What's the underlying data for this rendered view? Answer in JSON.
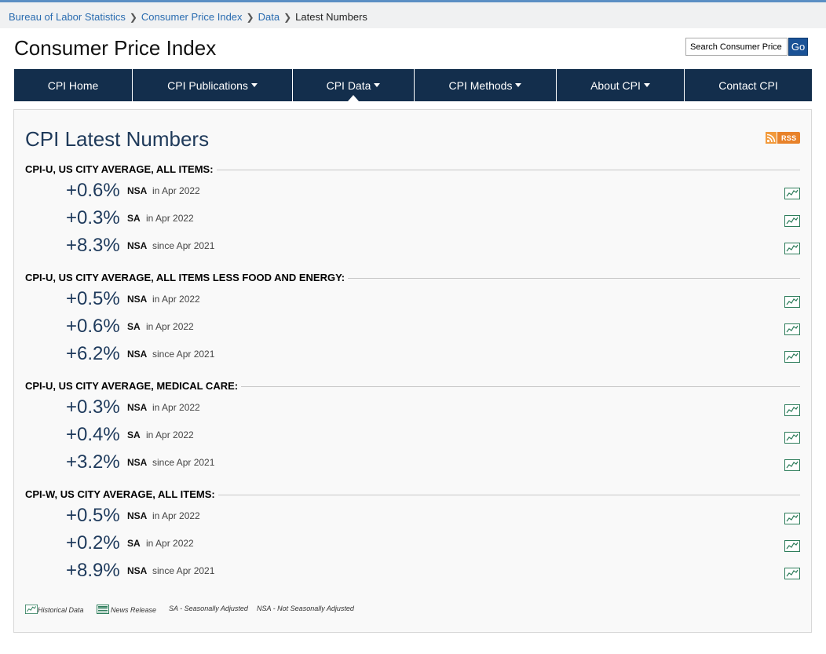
{
  "breadcrumb": [
    "Bureau of Labor Statistics",
    "Consumer Price Index",
    "Data",
    "Latest Numbers"
  ],
  "page_title": "Consumer Price Index",
  "search": {
    "placeholder": "Search Consumer Price",
    "button": "Go"
  },
  "nav": [
    {
      "label": "CPI Home",
      "dropdown": false
    },
    {
      "label": "CPI Publications",
      "dropdown": true
    },
    {
      "label": "CPI Data",
      "dropdown": true,
      "active": true
    },
    {
      "label": "CPI Methods",
      "dropdown": true
    },
    {
      "label": "About CPI",
      "dropdown": true
    },
    {
      "label": "Contact CPI",
      "dropdown": false
    }
  ],
  "panel": {
    "title": "CPI Latest Numbers",
    "rss": "RSS"
  },
  "sections": [
    {
      "title": "CPI-U, US CITY AVERAGE, ALL ITEMS:",
      "rows": [
        {
          "value": "+0.6%",
          "adj": "NSA",
          "period": "in Apr 2022"
        },
        {
          "value": "+0.3%",
          "adj": "SA",
          "period": "in Apr 2022"
        },
        {
          "value": "+8.3%",
          "adj": "NSA",
          "period": "since Apr 2021"
        }
      ]
    },
    {
      "title": "CPI-U, US CITY AVERAGE, ALL ITEMS LESS FOOD AND ENERGY:",
      "rows": [
        {
          "value": "+0.5%",
          "adj": "NSA",
          "period": "in Apr 2022"
        },
        {
          "value": "+0.6%",
          "adj": "SA",
          "period": "in Apr 2022"
        },
        {
          "value": "+6.2%",
          "adj": "NSA",
          "period": "since Apr 2021"
        }
      ]
    },
    {
      "title": "CPI-U, US CITY AVERAGE, MEDICAL CARE:",
      "rows": [
        {
          "value": "+0.3%",
          "adj": "NSA",
          "period": "in Apr 2022"
        },
        {
          "value": "+0.4%",
          "adj": "SA",
          "period": "in Apr 2022"
        },
        {
          "value": "+3.2%",
          "adj": "NSA",
          "period": "since Apr 2021"
        }
      ]
    },
    {
      "title": "CPI-W, US CITY AVERAGE, ALL ITEMS:",
      "rows": [
        {
          "value": "+0.5%",
          "adj": "NSA",
          "period": "in Apr 2022"
        },
        {
          "value": "+0.2%",
          "adj": "SA",
          "period": "in Apr 2022"
        },
        {
          "value": "+8.9%",
          "adj": "NSA",
          "period": "since Apr 2021"
        }
      ]
    }
  ],
  "legend": {
    "historical": "Historical Data",
    "news": "News Release",
    "sa": "SA - Seasonally Adjusted",
    "nsa": "NSA - Not Seasonally Adjusted"
  },
  "icons": {
    "chart": "historical-data-chart-icon",
    "news": "news-release-icon",
    "rss": "rss-feed-icon"
  },
  "colors": {
    "nav_bg": "#132e4c",
    "link": "#2a6cb0",
    "value": "#1e3a5c",
    "icon_green": "#2e7d5b",
    "rss": "#e8822a"
  }
}
